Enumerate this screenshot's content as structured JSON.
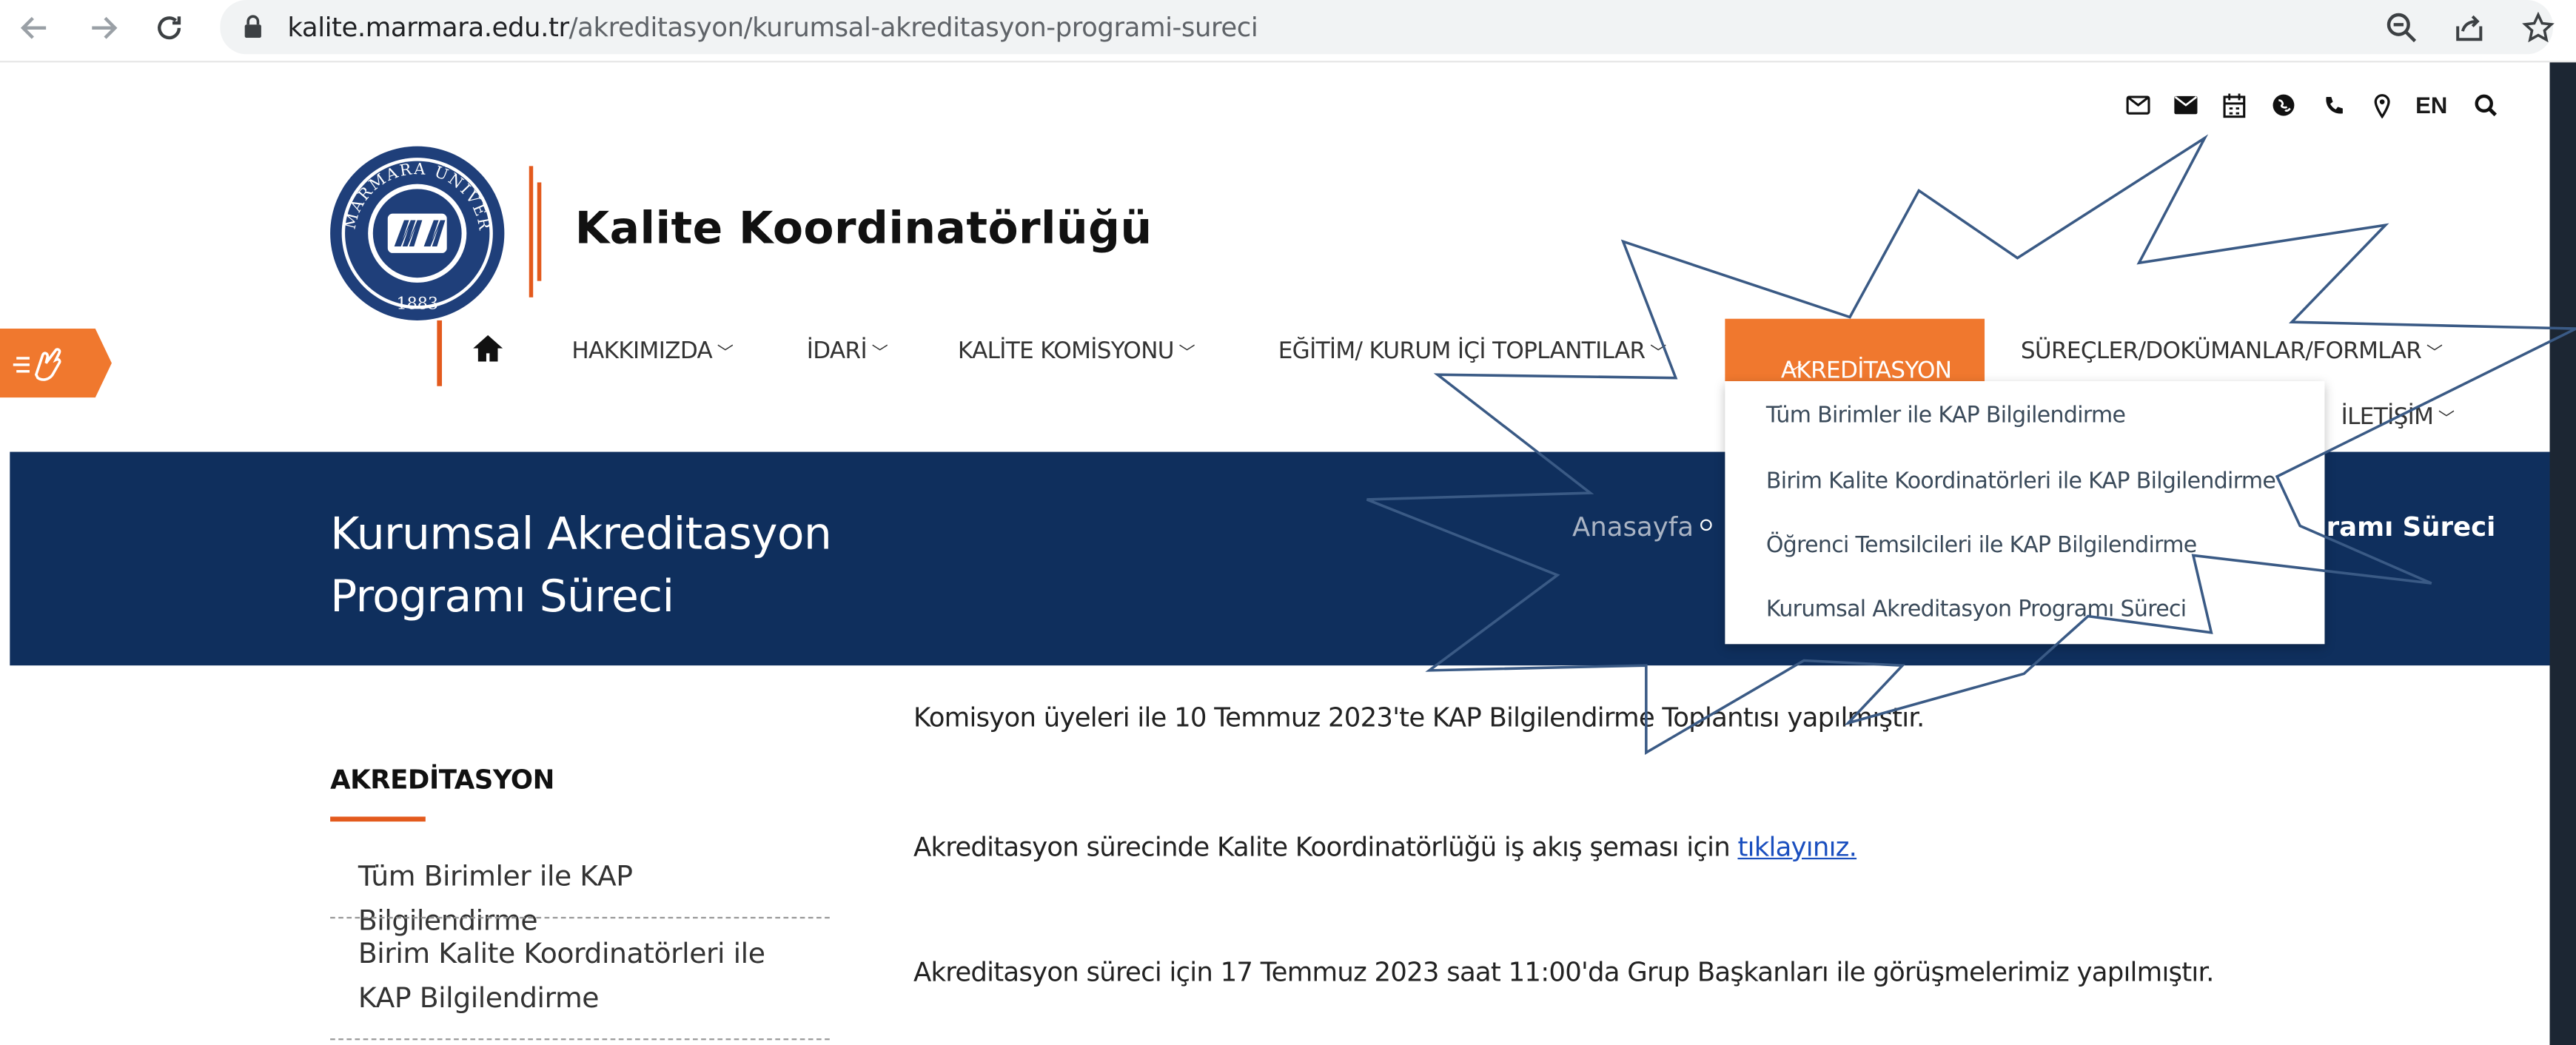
{
  "browser": {
    "url_host": "kalite.marmara.edu.tr",
    "url_path": "/akreditasyon/kurumsal-akreditasyon-programi-sureci"
  },
  "header": {
    "site_title": "Kalite Koordinatörlüğü",
    "logo_text_top": "MARMARA ÜNİVERSİTESİ",
    "logo_year": "1883",
    "lang": "EN"
  },
  "nav": {
    "items": [
      {
        "label": "HAKKIMIZDA"
      },
      {
        "label": "İDARİ"
      },
      {
        "label": "KALİTE KOMİSYONU"
      },
      {
        "label": "EĞİTİM/ KURUM İÇİ TOPLANTILAR"
      },
      {
        "label": "AKREDİTASYON"
      },
      {
        "label": "SÜREÇLER/DOKÜMANLAR/FORMLAR"
      },
      {
        "label": "İLETİŞİM"
      }
    ]
  },
  "dropdown": {
    "items": [
      {
        "label": "Tüm Birimler ile KAP Bilgilendirme"
      },
      {
        "label": "Birim Kalite Koordinatörleri ile KAP Bilgilendirme"
      },
      {
        "label": "Öğrenci Temsilcileri ile KAP Bilgilendirme"
      },
      {
        "label": "Kurumsal Akreditasyon Programı Süreci"
      }
    ]
  },
  "banner": {
    "title": "Kurumsal Akreditasyon Programı Süreci",
    "breadcrumb_home": "Anasayfa",
    "breadcrumb_current": "ramı Süreci"
  },
  "sidebar": {
    "heading": "AKREDİTASYON",
    "links": [
      {
        "label": "Tüm Birimler ile KAP Bilgilendirme"
      },
      {
        "label": "Birim Kalite Koordinatörleri ile KAP Bilgilendirme"
      }
    ]
  },
  "content": {
    "p1": "Komisyon üyeleri ile 10 Temmuz 2023'te KAP Bilgilendirme Toplantısı yapılmıştır.",
    "p2_text": "Akreditasyon sürecinde Kalite Koordinatörlüğü iş akış şeması için ",
    "p2_link": "tıklayınız.",
    "p3": "Akreditasyon süreci için 17 Temmuz 2023 saat 11:00'da Grup Başkanları ile görüşmelerimiz yapılmıştır."
  },
  "colors": {
    "accent_orange": "#f0782e",
    "banner_navy": "#0f2f5d",
    "logo_blue": "#1f3f7a",
    "burst_stroke": "#3a5a85"
  }
}
